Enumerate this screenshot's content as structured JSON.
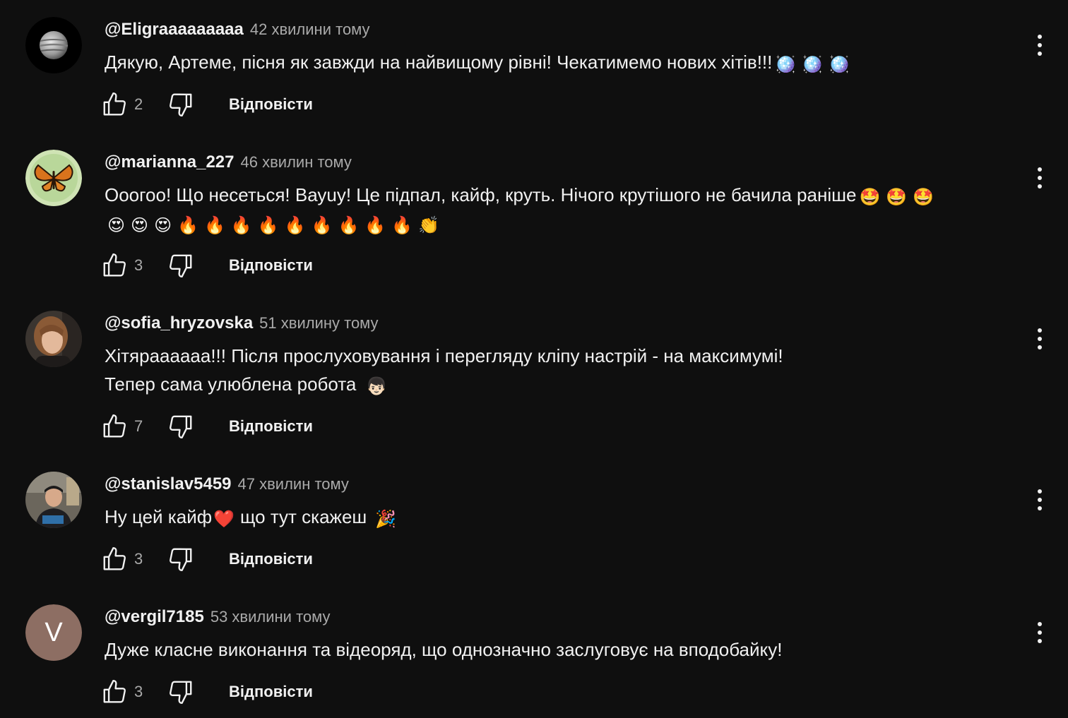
{
  "comments": [
    {
      "author": "@Eligraaaaaaaaa",
      "time": "42 хвилини тому",
      "lines": [
        "Дякую, Артеме, пісня як завжди на найвищому рівні! Чекатимемо нових хітів!!!"
      ],
      "emoji_line0": [
        "🪩",
        "🪩",
        "🪩"
      ],
      "likes": "2",
      "reply_label": "Відповісти",
      "avatar_icon": "planet-avatar"
    },
    {
      "author": "@marianna_227",
      "time": "46 хвилин тому",
      "lines": [
        "Ооогоо! Що несеться! Вауuу! Це підпал, кайф, круть. Нічого крутішого не бачила раніше"
      ],
      "emoji_line0": [
        "🤩",
        "🤩",
        "🤩"
      ],
      "emoji_line1": [
        "😍",
        "😍",
        "😍",
        "🔥",
        "🔥",
        "🔥",
        "🔥",
        "🔥",
        "🔥",
        "🔥",
        "🔥",
        "🔥",
        "👏"
      ],
      "likes": "3",
      "reply_label": "Відповісти",
      "avatar_icon": "butterfly-avatar"
    },
    {
      "author": "@sofia_hryzovska",
      "time": "51 хвилину тому",
      "lines": [
        "Хітяраааааа!!! Після прослуховування і перегляду кліпу настрій - на максимумі!",
        "Тепер сама улюблена робота"
      ],
      "emoji_line1": [
        "👦🏻"
      ],
      "likes": "7",
      "reply_label": "Відповісти",
      "avatar_icon": "profile-photo-avatar"
    },
    {
      "author": "@stanislav5459",
      "time": "47 хвилин тому",
      "lines": [
        "Ну цей кайф",
        "що тут скажеш"
      ],
      "emoji_mid": [
        "❤️"
      ],
      "emoji_end": [
        "🎉"
      ],
      "likes": "3",
      "reply_label": "Відповісти",
      "avatar_icon": "profile-photo-avatar"
    },
    {
      "author": "@vergil7185",
      "time": "53 хвилини тому",
      "lines": [
        "Дуже класне виконання та відеоряд, що однозначно заслуговує на вподобайку!"
      ],
      "avatar_letter": "V",
      "avatar_color": "#8d6e63",
      "likes": "3",
      "reply_label": "Відповісти"
    }
  ],
  "colors": {
    "background": "#0f0f0f",
    "text": "#f1f1f1",
    "secondary_text": "#aaaaaa"
  }
}
